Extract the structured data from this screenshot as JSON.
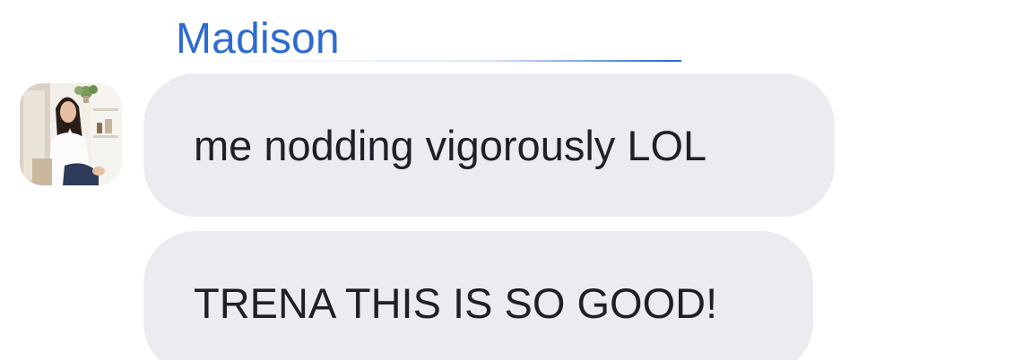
{
  "conversation": {
    "sender": {
      "name": "Madison",
      "name_color": "#2d6bd1",
      "avatar_icon": "user-avatar-photo"
    },
    "messages": [
      {
        "text": "me nodding vigorously LOL"
      },
      {
        "text": "TRENA THIS IS SO GOOD!"
      }
    ],
    "bubble_color": "#ececf0",
    "text_color": "#1f1f27"
  }
}
